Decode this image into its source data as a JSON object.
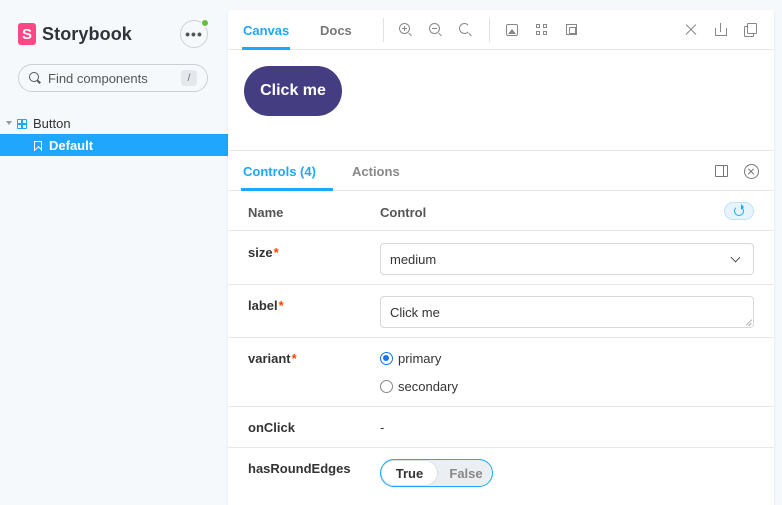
{
  "brand": {
    "logo_letter": "S",
    "name": "Storybook"
  },
  "sidebar": {
    "menu_label": "•••",
    "search": {
      "placeholder": "Find components",
      "shortcut": "/"
    },
    "tree": [
      {
        "label": "Button",
        "icon": "component-icon",
        "expanded": true,
        "stories": [
          {
            "label": "Default",
            "icon": "bookmark-icon",
            "selected": true
          }
        ]
      }
    ]
  },
  "toolbar": {
    "tabs": [
      {
        "label": "Canvas",
        "active": true
      },
      {
        "label": "Docs",
        "active": false
      }
    ],
    "tools": [
      "zoom-in-icon",
      "zoom-out-icon",
      "zoom-reset-icon",
      "background-icon",
      "grid-icon",
      "outline-icon"
    ],
    "right_tools": [
      "fullscreen-icon",
      "share-icon",
      "copy-link-icon"
    ]
  },
  "canvas": {
    "button_label": "Click me",
    "button_color": "#453d82"
  },
  "addons": {
    "tabs": [
      {
        "label": "Controls (4)",
        "active": true
      },
      {
        "label": "Actions",
        "active": false
      }
    ],
    "header": {
      "name": "Name",
      "control": "Control"
    },
    "rows": [
      {
        "name": "size",
        "required": "*",
        "control": "select",
        "value": "medium"
      },
      {
        "name": "label",
        "required": "*",
        "control": "text",
        "value": "Click me"
      },
      {
        "name": "variant",
        "required": "*",
        "control": "radio",
        "options": [
          {
            "label": "primary",
            "checked": true
          },
          {
            "label": "secondary",
            "checked": false
          }
        ]
      },
      {
        "name": "onClick",
        "required": "",
        "control": "none",
        "value": "-"
      },
      {
        "name": "hasRoundEdges",
        "required": "",
        "control": "boolean",
        "true_label": "True",
        "false_label": "False",
        "value": true
      }
    ]
  },
  "colors": {
    "accent": "#1ea7fd",
    "brand": "#ff4785",
    "required": "#ff4400",
    "status_dot": "#66bf3c"
  }
}
